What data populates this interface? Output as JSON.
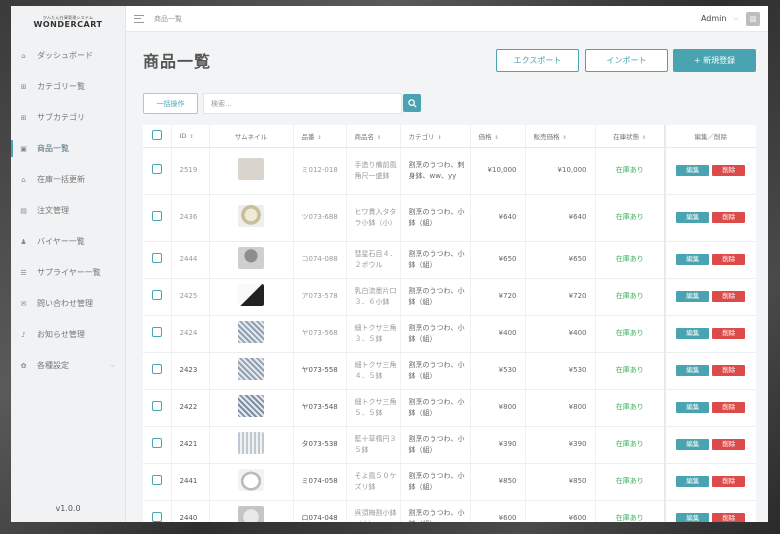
{
  "logo": {
    "subtitle": "かんたん在庫管理システム",
    "name": "WONDERCART"
  },
  "nav": [
    {
      "label": "ダッシュボード",
      "icon": "home-icon",
      "glyph": "⌂"
    },
    {
      "label": "カテゴリー覧",
      "icon": "grid-icon",
      "glyph": "⊞"
    },
    {
      "label": "サブカテゴリ",
      "icon": "grid-icon",
      "glyph": "⊞"
    },
    {
      "label": "商品一覧",
      "icon": "box-icon",
      "glyph": "▣",
      "active": true
    },
    {
      "label": "在庫一括更新",
      "icon": "refresh-icon",
      "glyph": "⌂"
    },
    {
      "label": "注文管理",
      "icon": "document-icon",
      "glyph": "▤"
    },
    {
      "label": "バイヤー一覧",
      "icon": "users-icon",
      "glyph": "♟"
    },
    {
      "label": "サプライヤー一覧",
      "icon": "list-icon",
      "glyph": "☰"
    },
    {
      "label": "問い合わせ管理",
      "icon": "mail-icon",
      "glyph": "✉"
    },
    {
      "label": "お知らせ管理",
      "icon": "bell-icon",
      "glyph": "♪"
    },
    {
      "label": "各種設定",
      "icon": "gear-icon",
      "glyph": "✿",
      "chevron": true
    }
  ],
  "version": "v1.0.0",
  "topbar": {
    "breadcrumb": "商品一覧",
    "user": "Admin"
  },
  "page": {
    "title": "商品一覧",
    "export_label": "エクスポート",
    "import_label": "インポート",
    "new_label": "+ 新規登録",
    "bulk_label": "一括操作",
    "search_placeholder": "検索..."
  },
  "table": {
    "headers": [
      "ID",
      "サムネイル",
      "品番",
      "商品名",
      "カテゴリ",
      "価格",
      "販売価格",
      "在庫状態",
      "編集／削除"
    ],
    "edit_label": "編集",
    "delete_label": "削除",
    "rows": [
      {
        "id": "2519",
        "code": "ミ012-018",
        "name": "手造り備前風角尺一盛鉢",
        "category": "割烹のうつわ、刺身鉢、ww、yy",
        "price": "¥10,000",
        "sale": "¥10,000",
        "stock": "在庫あり",
        "dim": true
      },
      {
        "id": "2436",
        "code": "ツ073-688",
        "name": "ヒワ貫入タタラ小鉢（小）",
        "category": "割烹のうつわ、小鉢（組）",
        "price": "¥640",
        "sale": "¥640",
        "stock": "在庫あり",
        "dim": true
      },
      {
        "id": "2444",
        "code": "コ074-088",
        "name": "彗星石目４．２ボウル",
        "category": "割烹のうつわ、小鉢（組）",
        "price": "¥650",
        "sale": "¥650",
        "stock": "在庫あり",
        "dim": true
      },
      {
        "id": "2425",
        "code": "ア073-578",
        "name": "乳白流墨片口３．６小鉢",
        "category": "割烹のうつわ、小鉢（組）",
        "price": "¥720",
        "sale": "¥720",
        "stock": "在庫あり",
        "dim": true
      },
      {
        "id": "2424",
        "code": "ヤ073-568",
        "name": "細トクサ三角３．５鉢",
        "category": "割烹のうつわ、小鉢（組）",
        "price": "¥400",
        "sale": "¥400",
        "stock": "在庫あり",
        "dim": true
      },
      {
        "id": "2423",
        "code": "ヤ073-558",
        "name": "細トクサ三角４．５鉢",
        "category": "割烹のうつわ、小鉢（組）",
        "price": "¥530",
        "sale": "¥530",
        "stock": "在庫あり",
        "dim": false
      },
      {
        "id": "2422",
        "code": "ヤ073-548",
        "name": "細トクサ三角５．５鉢",
        "category": "割烹のうつわ、小鉢（組）",
        "price": "¥800",
        "sale": "¥800",
        "stock": "在庫あり",
        "dim": false
      },
      {
        "id": "2421",
        "code": "タ073-538",
        "name": "藍十草楕円３５鉢",
        "category": "割烹のうつわ、小鉢（組）",
        "price": "¥390",
        "sale": "¥390",
        "stock": "在庫あり",
        "dim": false
      },
      {
        "id": "2441",
        "code": "ミ074-058",
        "name": "そよ風５０ケズリ鉢",
        "category": "割烹のうつわ、小鉢（組）",
        "price": "¥850",
        "sale": "¥850",
        "stock": "在庫あり",
        "dim": false
      },
      {
        "id": "2440",
        "code": "ロ074-048",
        "name": "呉須梅割小鉢（小）",
        "category": "割烹のうつわ、小鉢（組）",
        "price": "¥600",
        "sale": "¥600",
        "stock": "在庫あり",
        "dim": false
      }
    ]
  },
  "colors": {
    "accent": "#4aa3b0",
    "danger": "#dd4a4a",
    "stock": "#3fae5e"
  }
}
